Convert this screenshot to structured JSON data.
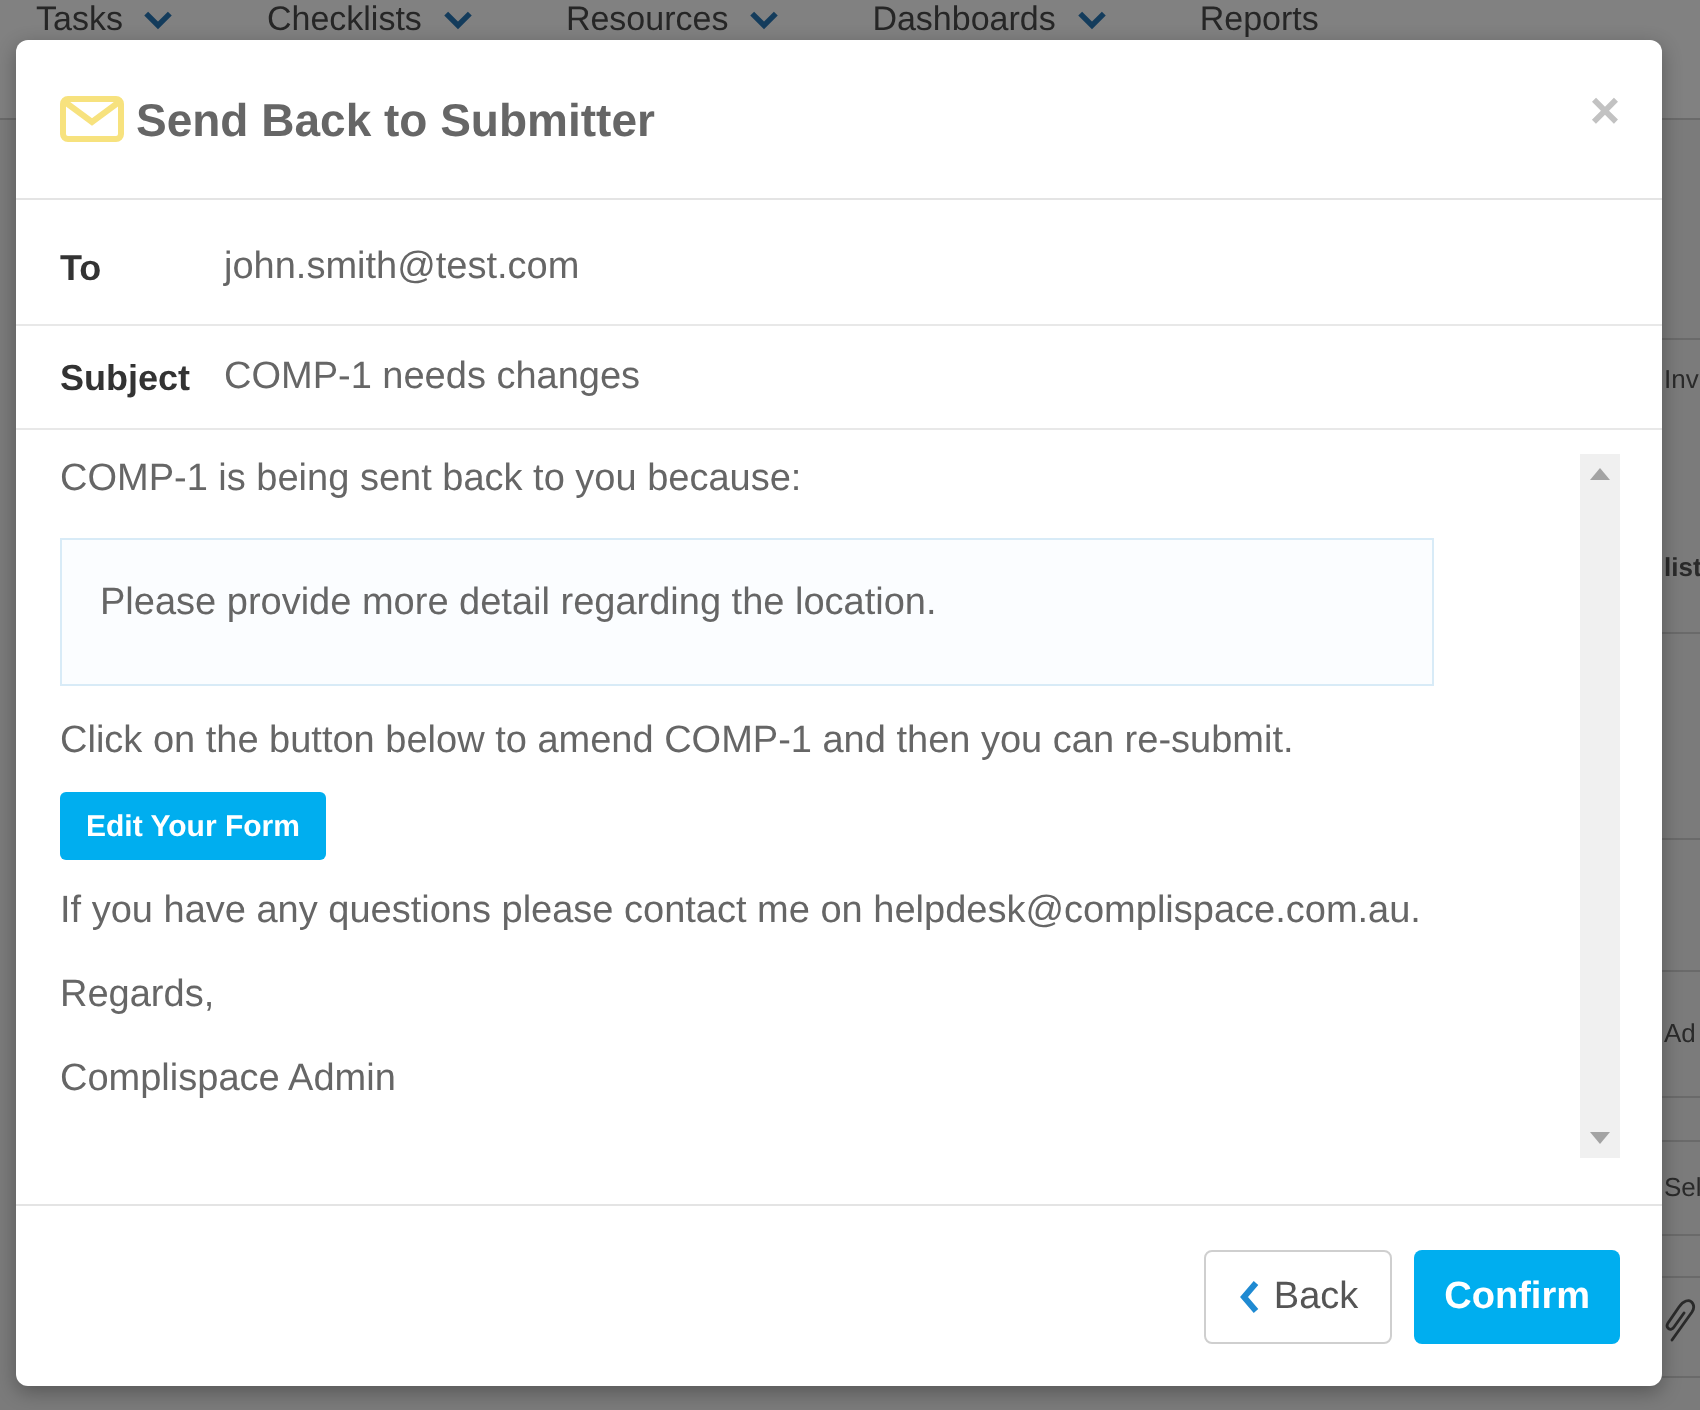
{
  "background": {
    "nav": [
      {
        "label": "Tasks",
        "dropdown": true
      },
      {
        "label": "Checklists",
        "dropdown": true
      },
      {
        "label": "Resources",
        "dropdown": true
      },
      {
        "label": "Dashboards",
        "dropdown": true
      },
      {
        "label": "Reports",
        "dropdown": false
      }
    ],
    "table_fragments": [
      {
        "text": "Inv",
        "kind": "cell"
      },
      {
        "text": "list",
        "kind": "header"
      },
      {
        "text": "Ad",
        "kind": "cell"
      },
      {
        "text": "Sel",
        "kind": "cell"
      }
    ]
  },
  "dialog": {
    "title": "Send Back to Submitter",
    "close": "×",
    "fields": [
      {
        "label": "To",
        "value": "john.smith@test.com"
      },
      {
        "label": "Subject",
        "value": "COMP-1 needs changes"
      }
    ],
    "message": [
      {
        "kind": "text",
        "text": "COMP-1 is being sent back to you because:"
      },
      {
        "kind": "quote",
        "text": "Please provide more detail regarding the location."
      },
      {
        "kind": "text",
        "text": "Click on the button below to amend COMP-1 and then you can re-submit."
      },
      {
        "kind": "button",
        "text": "Edit Your Form"
      },
      {
        "kind": "text",
        "text": "If you have any questions please contact me on helpdesk@complispace.com.au."
      },
      {
        "kind": "text",
        "text": "Regards,"
      },
      {
        "kind": "text",
        "text": "Complispace Admin"
      }
    ],
    "buttons": [
      {
        "kind": "back",
        "label": "Back"
      },
      {
        "kind": "confirm",
        "label": "Confirm"
      }
    ]
  }
}
